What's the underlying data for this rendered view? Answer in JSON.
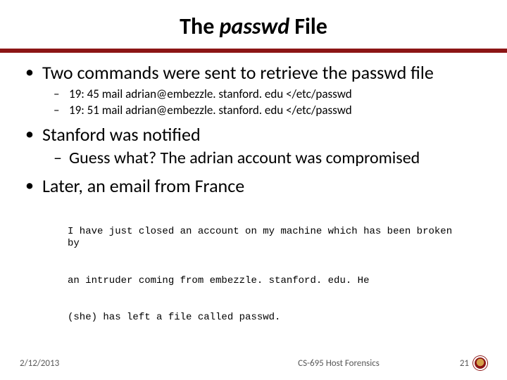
{
  "title": {
    "pre": "The ",
    "italic": "passwd",
    "post": " File"
  },
  "b1a": "Two commands were sent to retrieve the passwd file",
  "b2a": "19: 45 mail adrian@embezzle. stanford. edu </etc/passwd",
  "b2b": "19: 51 mail adrian@embezzle. stanford. edu </etc/passwd",
  "b1b": "Stanford was notified",
  "b2c": "Guess what? The adrian account was compromised",
  "b1c": "Later, an email from France",
  "mono1": "I have just closed an account on my machine which has been broken by",
  "mono2": "an intruder coming from embezzle. stanford. edu. He",
  "mono3": "(she) has left a file called passwd.",
  "footer": {
    "date": "2/12/2013",
    "middle": "CS-695 Host Forensics",
    "page": "21"
  }
}
